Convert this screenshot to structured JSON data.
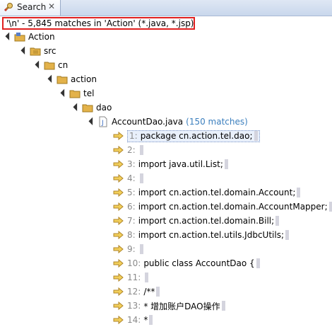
{
  "tab": {
    "label": "Search",
    "icon": "search-icon",
    "close_glyph": "✕"
  },
  "status": {
    "text": "'\\n' - 5,845 matches in 'Action' (*.java, *.jsp)"
  },
  "tree": {
    "project": "Action",
    "folders": [
      "src",
      "cn",
      "action",
      "tel",
      "dao"
    ],
    "file": {
      "name": "AccountDao.java",
      "matches": "(150 matches)"
    },
    "lines": [
      {
        "num": "1:",
        "text": "package cn.action.tel.dao;"
      },
      {
        "num": "2:",
        "text": ""
      },
      {
        "num": "3:",
        "text": "import java.util.List;"
      },
      {
        "num": "4:",
        "text": ""
      },
      {
        "num": "5:",
        "text": "import cn.action.tel.domain.Account;"
      },
      {
        "num": "6:",
        "text": "import cn.action.tel.domain.AccountMapper;"
      },
      {
        "num": "7:",
        "text": "import cn.action.tel.domain.Bill;"
      },
      {
        "num": "8:",
        "text": "import cn.action.tel.utils.JdbcUtils;"
      },
      {
        "num": "9:",
        "text": ""
      },
      {
        "num": "10:",
        "text": "public class AccountDao {"
      },
      {
        "num": "11:",
        "text": ""
      },
      {
        "num": "12:",
        "text": "/**"
      },
      {
        "num": "13:",
        "text": "* 增加账户DAO操作"
      },
      {
        "num": "14:",
        "text": "*"
      }
    ]
  },
  "colors": {
    "border_highlight": "#e02020",
    "match_count": "#3b7fbe",
    "folder": "#e3b24a"
  }
}
